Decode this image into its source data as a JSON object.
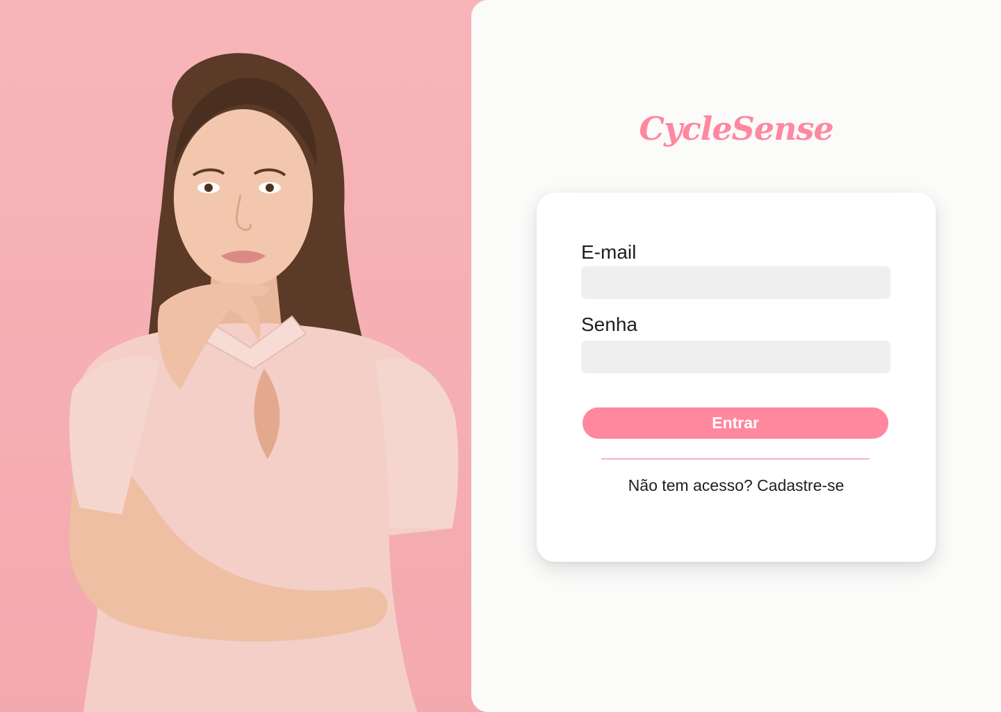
{
  "brand": {
    "name": "CycleSense",
    "color": "#ff87a0"
  },
  "hero_image": {
    "description_icon": "woman-portrait-photo",
    "background_color": "#f8b8bd"
  },
  "login_form": {
    "email_label": "E-mail",
    "email_value": "",
    "email_placeholder": "",
    "password_label": "Senha",
    "password_value": "",
    "password_placeholder": "",
    "submit_label": "Entrar",
    "submit_color": "#ff879e"
  },
  "signup": {
    "prompt": "Não tem acesso?",
    "link_label": "Cadastre-se"
  }
}
